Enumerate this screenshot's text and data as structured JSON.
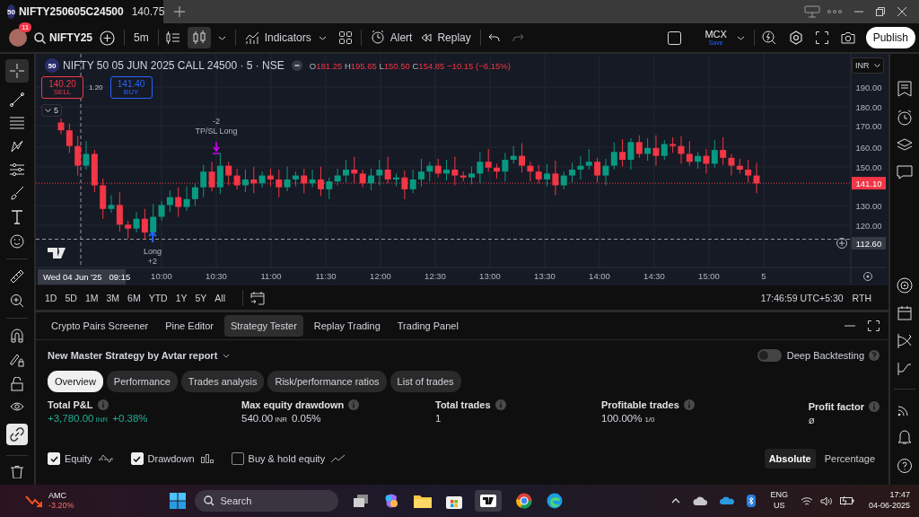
{
  "tab": {
    "badge": "50",
    "title": "NIFTY250605C24500",
    "price": "140.75",
    "selected": true
  },
  "toolbar": {
    "alerts_badge": "11",
    "symbol": "NIFTY25",
    "interval": "5m",
    "indicators": "Indicators",
    "alert": "Alert",
    "replay": "Replay",
    "layout_name": "MCX",
    "layout_status": "Save",
    "publish": "Publish"
  },
  "chart": {
    "badge": "50",
    "title": "NIFTY 50 05 JUN 2025 CALL 24500 · 5 · NSE",
    "ohlc": [
      {
        "label": "O",
        "value": "181.25"
      },
      {
        "label": "H",
        "value": "195.65"
      },
      {
        "label": "L",
        "value": "150.50"
      },
      {
        "label": "C",
        "value": "154.85"
      }
    ],
    "change": "−10.15 (−6.15%)",
    "sell": {
      "price": "140.20",
      "label": "SELL"
    },
    "spread": "1.20",
    "buy": {
      "price": "141.40",
      "label": "BUY"
    },
    "collapsed_count": "5",
    "currency": "INR",
    "price_ticks": [
      "190.00",
      "180.00",
      "170.00",
      "160.00",
      "150.00",
      "130.00",
      "120.00"
    ],
    "current_price": "141.10",
    "crosshair_price": "112.60",
    "time_ticks": [
      "10:00",
      "10:30",
      "11:00",
      "11:30",
      "12:00",
      "12:30",
      "13:00",
      "13:30",
      "14:00",
      "14:30",
      "15:00",
      "5"
    ],
    "crosshair_time": "Wed 04 Jun '25   09:15",
    "exit_marker": {
      "quantity": "-2",
      "label": "TP/SL Long"
    },
    "entry_marker": {
      "label": "Long",
      "quantity": "+2"
    }
  },
  "ranges": [
    "1D",
    "5D",
    "1M",
    "3M",
    "6M",
    "YTD",
    "1Y",
    "5Y",
    "All"
  ],
  "clock": "17:46:59 UTC+5:30",
  "session": "RTH",
  "panel": {
    "tabs": [
      {
        "label": "Crypto Pairs Screener",
        "selected": false
      },
      {
        "label": "Pine Editor",
        "selected": false
      },
      {
        "label": "Strategy Tester",
        "selected": true
      },
      {
        "label": "Replay Trading",
        "selected": false
      },
      {
        "label": "Trading Panel",
        "selected": false
      }
    ],
    "strategy": "New Master Strategy by Avtar report",
    "deep_backtesting": {
      "label": "Deep Backtesting",
      "on": false
    },
    "subtabs": [
      {
        "label": "Overview",
        "selected": true
      },
      {
        "label": "Performance",
        "selected": false
      },
      {
        "label": "Trades analysis",
        "selected": false
      },
      {
        "label": "Risk/performance ratios",
        "selected": false
      },
      {
        "label": "List of trades",
        "selected": false
      }
    ],
    "metrics": [
      {
        "label": "Total P&L",
        "value": "+3,780.00",
        "unit": "INR",
        "extra": "+0.38%",
        "color": "#22ab94"
      },
      {
        "label": "Max equity drawdown",
        "value": "540.00",
        "unit": "INR",
        "extra": "0.05%"
      },
      {
        "label": "Total trades",
        "value": "1"
      },
      {
        "label": "Profitable trades",
        "value": "100.00%",
        "extra": "1/0"
      },
      {
        "label": "Profit factor",
        "value": "ø"
      }
    ],
    "toggles": [
      {
        "label": "Equity",
        "kind": "equity",
        "checked": true
      },
      {
        "label": "Drawdown",
        "kind": "drawdown",
        "checked": true
      },
      {
        "label": "Buy & hold equity",
        "kind": "buyhold",
        "checked": false
      }
    ],
    "modes": [
      {
        "label": "Absolute",
        "selected": true
      },
      {
        "label": "Percentage",
        "selected": false
      }
    ]
  },
  "taskbar": {
    "ticker": {
      "symbol": "AMC",
      "change": "-3.20%"
    },
    "search_placeholder": "Search",
    "language": "ENG",
    "region": "US",
    "time": "17:47",
    "date": "04-06-2025"
  }
}
